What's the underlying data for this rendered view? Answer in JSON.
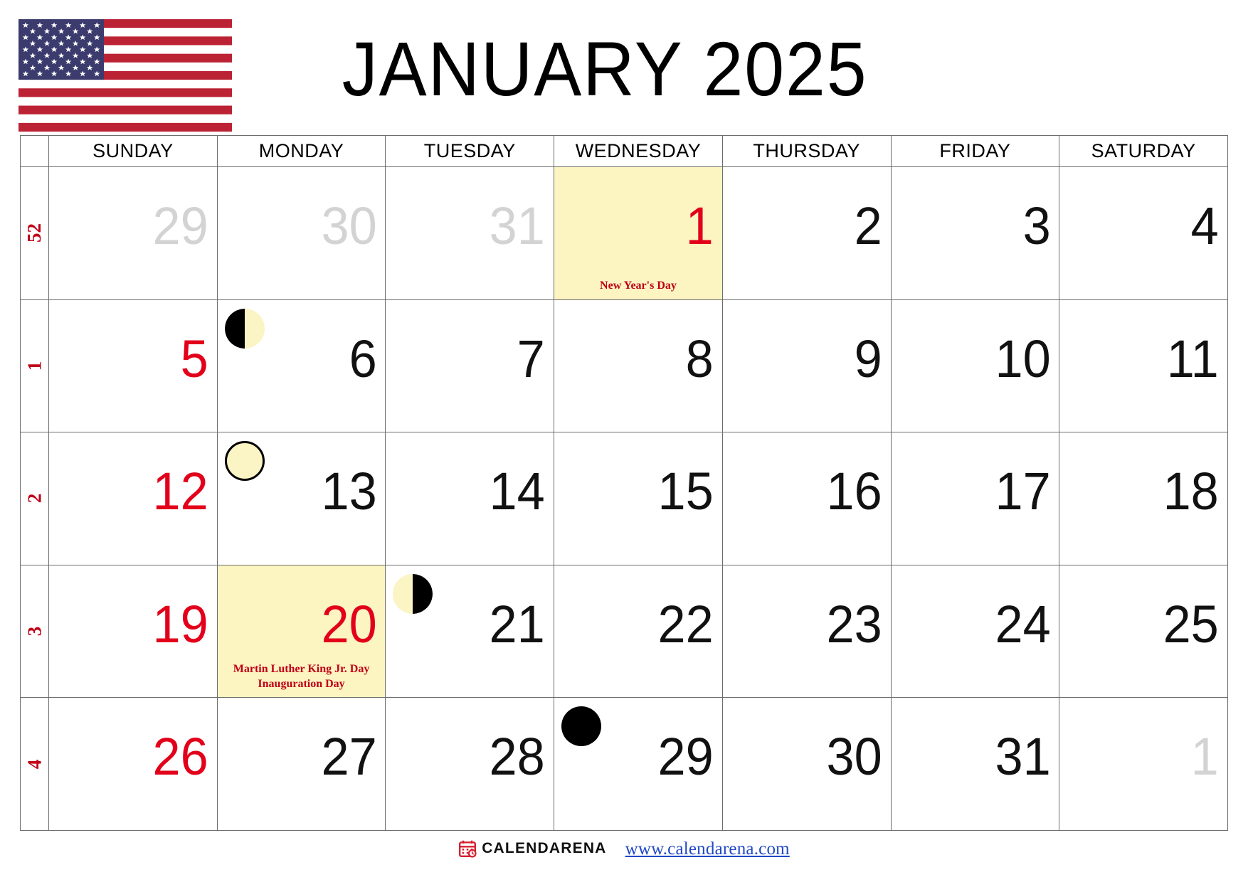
{
  "header": {
    "flag_icon": "us-flag-icon",
    "title": "JANUARY 2025",
    "colors": {
      "flag_red": "#bb2334",
      "flag_blue": "#3c3b6e",
      "flag_white": "#ffffff"
    }
  },
  "theme": {
    "sunday_red": "#e2001a",
    "holiday_text_red": "#c00018",
    "weeknum_red": "#c00018",
    "highlight_yellow": "#fcf4c1",
    "muted_gray": "#d3d3d3",
    "grid_line": "#6d6d6d",
    "link_blue": "#2048c8"
  },
  "calendar": {
    "weeknum_header": "",
    "day_headers": [
      "SUNDAY",
      "MONDAY",
      "TUESDAY",
      "WEDNESDAY",
      "THURSDAY",
      "FRIDAY",
      "SATURDAY"
    ],
    "weeks": [
      {
        "week_number": "52",
        "days": [
          {
            "num": "29",
            "muted": true,
            "sunday": true,
            "highlight": false,
            "events": [],
            "moon": null
          },
          {
            "num": "30",
            "muted": true,
            "sunday": false,
            "highlight": false,
            "events": [],
            "moon": null
          },
          {
            "num": "31",
            "muted": true,
            "sunday": false,
            "highlight": false,
            "events": [],
            "moon": null
          },
          {
            "num": "1",
            "muted": false,
            "sunday": false,
            "highlight": true,
            "events": [
              "New Year's Day"
            ],
            "moon": null
          },
          {
            "num": "2",
            "muted": false,
            "sunday": false,
            "highlight": false,
            "events": [],
            "moon": null
          },
          {
            "num": "3",
            "muted": false,
            "sunday": false,
            "highlight": false,
            "events": [],
            "moon": null
          },
          {
            "num": "4",
            "muted": false,
            "sunday": false,
            "highlight": false,
            "events": [],
            "moon": null
          }
        ]
      },
      {
        "week_number": "1",
        "days": [
          {
            "num": "5",
            "muted": false,
            "sunday": true,
            "highlight": false,
            "events": [],
            "moon": null
          },
          {
            "num": "6",
            "muted": false,
            "sunday": false,
            "highlight": false,
            "events": [],
            "moon": "first-quarter"
          },
          {
            "num": "7",
            "muted": false,
            "sunday": false,
            "highlight": false,
            "events": [],
            "moon": null
          },
          {
            "num": "8",
            "muted": false,
            "sunday": false,
            "highlight": false,
            "events": [],
            "moon": null
          },
          {
            "num": "9",
            "muted": false,
            "sunday": false,
            "highlight": false,
            "events": [],
            "moon": null
          },
          {
            "num": "10",
            "muted": false,
            "sunday": false,
            "highlight": false,
            "events": [],
            "moon": null
          },
          {
            "num": "11",
            "muted": false,
            "sunday": false,
            "highlight": false,
            "events": [],
            "moon": null
          }
        ]
      },
      {
        "week_number": "2",
        "days": [
          {
            "num": "12",
            "muted": false,
            "sunday": true,
            "highlight": false,
            "events": [],
            "moon": null
          },
          {
            "num": "13",
            "muted": false,
            "sunday": false,
            "highlight": false,
            "events": [],
            "moon": "full-moon"
          },
          {
            "num": "14",
            "muted": false,
            "sunday": false,
            "highlight": false,
            "events": [],
            "moon": null
          },
          {
            "num": "15",
            "muted": false,
            "sunday": false,
            "highlight": false,
            "events": [],
            "moon": null
          },
          {
            "num": "16",
            "muted": false,
            "sunday": false,
            "highlight": false,
            "events": [],
            "moon": null
          },
          {
            "num": "17",
            "muted": false,
            "sunday": false,
            "highlight": false,
            "events": [],
            "moon": null
          },
          {
            "num": "18",
            "muted": false,
            "sunday": false,
            "highlight": false,
            "events": [],
            "moon": null
          }
        ]
      },
      {
        "week_number": "3",
        "days": [
          {
            "num": "19",
            "muted": false,
            "sunday": true,
            "highlight": false,
            "events": [],
            "moon": null
          },
          {
            "num": "20",
            "muted": false,
            "sunday": false,
            "highlight": true,
            "events": [
              "Martin Luther King Jr. Day",
              "Inauguration Day"
            ],
            "moon": null
          },
          {
            "num": "21",
            "muted": false,
            "sunday": false,
            "highlight": false,
            "events": [],
            "moon": "last-quarter"
          },
          {
            "num": "22",
            "muted": false,
            "sunday": false,
            "highlight": false,
            "events": [],
            "moon": null
          },
          {
            "num": "23",
            "muted": false,
            "sunday": false,
            "highlight": false,
            "events": [],
            "moon": null
          },
          {
            "num": "24",
            "muted": false,
            "sunday": false,
            "highlight": false,
            "events": [],
            "moon": null
          },
          {
            "num": "25",
            "muted": false,
            "sunday": false,
            "highlight": false,
            "events": [],
            "moon": null
          }
        ]
      },
      {
        "week_number": "4",
        "days": [
          {
            "num": "26",
            "muted": false,
            "sunday": true,
            "highlight": false,
            "events": [],
            "moon": null
          },
          {
            "num": "27",
            "muted": false,
            "sunday": false,
            "highlight": false,
            "events": [],
            "moon": null
          },
          {
            "num": "28",
            "muted": false,
            "sunday": false,
            "highlight": false,
            "events": [],
            "moon": null
          },
          {
            "num": "29",
            "muted": false,
            "sunday": false,
            "highlight": false,
            "events": [],
            "moon": "new-moon"
          },
          {
            "num": "30",
            "muted": false,
            "sunday": false,
            "highlight": false,
            "events": [],
            "moon": null
          },
          {
            "num": "31",
            "muted": false,
            "sunday": false,
            "highlight": false,
            "events": [],
            "moon": null
          },
          {
            "num": "1",
            "muted": true,
            "sunday": false,
            "highlight": false,
            "events": [],
            "moon": null
          }
        ]
      }
    ]
  },
  "footer": {
    "brand_icon": "calendar-clock-icon",
    "brand_name": "CALENDARENA",
    "site_url": "www.calendarena.com"
  }
}
